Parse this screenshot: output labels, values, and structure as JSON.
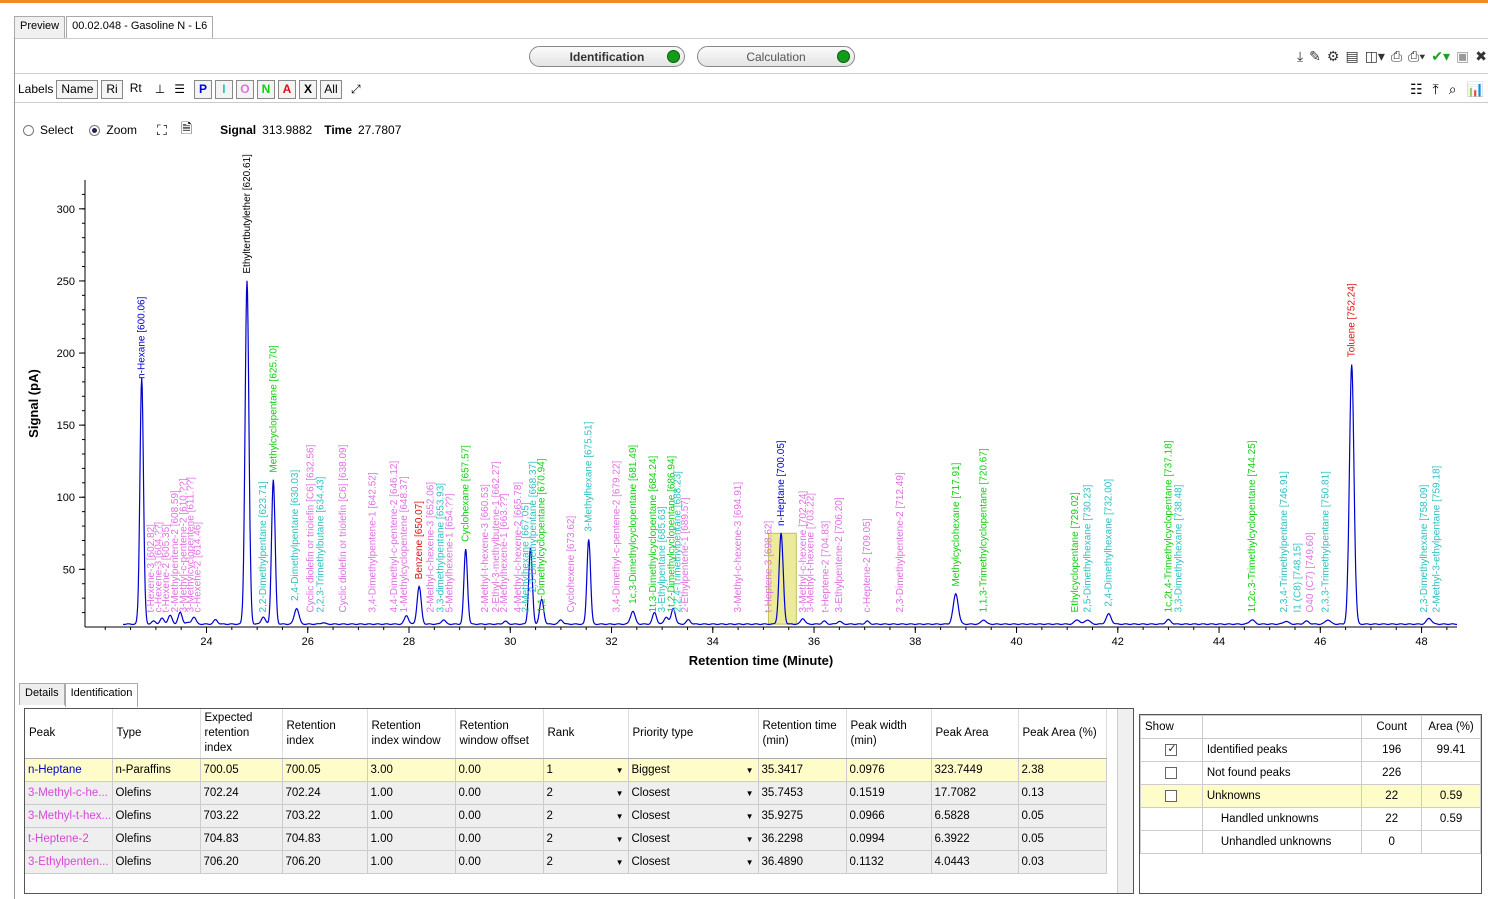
{
  "tabs": [
    {
      "label": "Preview"
    },
    {
      "label": "00.02.048 - Gasoline N - L6"
    }
  ],
  "toolbar": {
    "identification_label": "Identification",
    "calculation_label": "Calculation"
  },
  "label_bar": {
    "labels_label": "Labels",
    "name_btn": "Name",
    "ri_btn": "Ri",
    "rt_btn": "Rt",
    "class_buttons": [
      {
        "label": "P",
        "color": "#0000d0"
      },
      {
        "label": "I",
        "color": "#30c0c0"
      },
      {
        "label": "O",
        "color": "#e070e0"
      },
      {
        "label": "N",
        "color": "#10d010"
      },
      {
        "label": "A",
        "color": "#e01010"
      },
      {
        "label": "X",
        "color": "#000000"
      },
      {
        "label": "All",
        "color": "#000000"
      }
    ]
  },
  "select_bar": {
    "select_label": "Select",
    "zoom_label": "Zoom",
    "signal_label": "Signal",
    "signal_value": "313.9882",
    "time_label": "Time",
    "time_value": "27.7807"
  },
  "chart_data": {
    "type": "line",
    "xlabel": "Retention time (Minute)",
    "ylabel": "Signal (pA)",
    "xlim": [
      21.6,
      48.7
    ],
    "ylim": [
      10,
      320
    ],
    "xticks": [
      24,
      26,
      28,
      30,
      32,
      34,
      36,
      38,
      40,
      42,
      44,
      46,
      48
    ],
    "yticks": [
      50,
      100,
      150,
      200,
      250,
      300
    ],
    "baseline": 12,
    "highlight_range": [
      35.1,
      35.65
    ],
    "peaks": [
      {
        "t": 22.72,
        "h": 183,
        "w": 0.035
      },
      {
        "t": 22.95,
        "h": 14,
        "w": 0.04
      },
      {
        "t": 23.12,
        "h": 16,
        "w": 0.04
      },
      {
        "t": 23.28,
        "h": 18,
        "w": 0.04
      },
      {
        "t": 23.48,
        "h": 20,
        "w": 0.04
      },
      {
        "t": 23.62,
        "h": 13,
        "w": 0.04
      },
      {
        "t": 23.75,
        "h": 17,
        "w": 0.04
      },
      {
        "t": 24.18,
        "h": 15,
        "w": 0.04
      },
      {
        "t": 24.8,
        "h": 250,
        "w": 0.038
      },
      {
        "t": 25.12,
        "h": 17,
        "w": 0.04
      },
      {
        "t": 25.32,
        "h": 112,
        "w": 0.035
      },
      {
        "t": 25.78,
        "h": 23,
        "w": 0.045
      },
      {
        "t": 26.3,
        "h": 13,
        "w": 0.04
      },
      {
        "t": 27.95,
        "h": 18,
        "w": 0.04
      },
      {
        "t": 28.2,
        "h": 38,
        "w": 0.04
      },
      {
        "t": 28.68,
        "h": 15,
        "w": 0.04
      },
      {
        "t": 29.12,
        "h": 64,
        "w": 0.035
      },
      {
        "t": 29.9,
        "h": 14,
        "w": 0.04
      },
      {
        "t": 30.4,
        "h": 65,
        "w": 0.035
      },
      {
        "t": 30.62,
        "h": 29,
        "w": 0.04
      },
      {
        "t": 31.0,
        "h": 15,
        "w": 0.04
      },
      {
        "t": 31.55,
        "h": 71,
        "w": 0.035
      },
      {
        "t": 32.42,
        "h": 21,
        "w": 0.045
      },
      {
        "t": 32.85,
        "h": 20,
        "w": 0.04
      },
      {
        "t": 33.08,
        "h": 17,
        "w": 0.04
      },
      {
        "t": 33.22,
        "h": 23,
        "w": 0.04
      },
      {
        "t": 33.52,
        "h": 15,
        "w": 0.04
      },
      {
        "t": 35.35,
        "h": 75,
        "w": 0.04
      },
      {
        "t": 35.78,
        "h": 16,
        "w": 0.04
      },
      {
        "t": 36.2,
        "h": 14,
        "w": 0.04
      },
      {
        "t": 36.5,
        "h": 14,
        "w": 0.04
      },
      {
        "t": 37.05,
        "h": 14,
        "w": 0.04
      },
      {
        "t": 38.8,
        "h": 33,
        "w": 0.05
      },
      {
        "t": 39.35,
        "h": 15,
        "w": 0.045
      },
      {
        "t": 41.2,
        "h": 15,
        "w": 0.05
      },
      {
        "t": 41.4,
        "h": 15,
        "w": 0.05
      },
      {
        "t": 41.82,
        "h": 19,
        "w": 0.05
      },
      {
        "t": 43.0,
        "h": 15,
        "w": 0.05
      },
      {
        "t": 44.65,
        "h": 15,
        "w": 0.05
      },
      {
        "t": 45.32,
        "h": 14,
        "w": 0.05
      },
      {
        "t": 45.73,
        "h": 14,
        "w": 0.05
      },
      {
        "t": 46.15,
        "h": 15,
        "w": 0.05
      },
      {
        "t": 46.62,
        "h": 192,
        "w": 0.045
      },
      {
        "t": 48.15,
        "h": 16,
        "w": 0.05
      }
    ],
    "labels": [
      {
        "t": 22.72,
        "text": "n-Hexane [600.06]",
        "color": "#0000d0",
        "y": 180
      },
      {
        "t": 22.9,
        "text": "t-Hexene-3 [602.82]",
        "color": "#e070e0",
        "y": 18
      },
      {
        "t": 23.05,
        "text": "c-Hexene-3 [604.??]",
        "color": "#e070e0",
        "y": 18
      },
      {
        "t": 23.2,
        "text": "t-Hexene-2 [605.35]",
        "color": "#e070e0",
        "y": 18
      },
      {
        "t": 23.38,
        "text": "2-Methylpentene-2 [608.59]",
        "color": "#e070e0",
        "y": 18
      },
      {
        "t": 23.55,
        "text": "3-Methyl-c-pentene-2 [610.??]",
        "color": "#e070e0",
        "y": 18
      },
      {
        "t": 23.68,
        "text": "3-Methylcyclopentene [611.??]",
        "color": "#e070e0",
        "y": 18
      },
      {
        "t": 23.82,
        "text": "c-Hexene-2 [614.46]",
        "color": "#e070e0",
        "y": 18
      },
      {
        "t": 24.8,
        "text": "Ethyltertbutylether [620.61]",
        "color": "#000000",
        "y": 253
      },
      {
        "t": 25.12,
        "text": "2,2-Dimethylpentane [623.71]",
        "color": "#30c0c0",
        "y": 18
      },
      {
        "t": 25.32,
        "text": "Methylcyclopentane [625.70]",
        "color": "#10d010",
        "y": 115
      },
      {
        "t": 25.75,
        "text": "2,4-Dimethylpentane [630.03]",
        "color": "#30c0c0",
        "y": 26
      },
      {
        "t": 26.05,
        "text": "Cyclic diolefin or triolefin [C6] [632.56]",
        "color": "#e070e0",
        "y": 18
      },
      {
        "t": 26.25,
        "text": "2,2,3-Trimethylbutane [634.43]",
        "color": "#30c0c0",
        "y": 18
      },
      {
        "t": 26.7,
        "text": "Cyclic diolefin or triolefin [C6] [638.09]",
        "color": "#e070e0",
        "y": 18
      },
      {
        "t": 27.28,
        "text": "3,4-Dimethylpentene-1 [642.52]",
        "color": "#e070e0",
        "y": 18
      },
      {
        "t": 27.7,
        "text": "4,4-Dimethyl-c-pentene-2 [646.12]",
        "color": "#e070e0",
        "y": 18
      },
      {
        "t": 27.9,
        "text": "1-Methylcyclopentene [648.37]",
        "color": "#e070e0",
        "y": 18
      },
      {
        "t": 28.2,
        "text": "Benzene [650.07]",
        "color": "#e01010",
        "y": 41
      },
      {
        "t": 28.42,
        "text": "2-Methyl-c-hexene-3 [652.06]",
        "color": "#e070e0",
        "y": 18
      },
      {
        "t": 28.62,
        "text": "3,3-dimethylpentane [653.93]",
        "color": "#30c0c0",
        "y": 18
      },
      {
        "t": 28.8,
        "text": "5-Methylhexene-1 [654.??]",
        "color": "#e070e0",
        "y": 18
      },
      {
        "t": 29.12,
        "text": "Cyclohexane [657.57]",
        "color": "#10d010",
        "y": 67
      },
      {
        "t": 29.5,
        "text": "2-Methyl-t-hexene-3 [660.53]",
        "color": "#e070e0",
        "y": 18
      },
      {
        "t": 29.72,
        "text": "2-Ethyl-3-methylbutene-1 [662.27]",
        "color": "#e070e0",
        "y": 18
      },
      {
        "t": 29.88,
        "text": "2-Methylhexene-1 [663.??]",
        "color": "#e070e0",
        "y": 18
      },
      {
        "t": 30.15,
        "text": "4-Methyl-c-hexene-2 [665.78]",
        "color": "#e070e0",
        "y": 18
      },
      {
        "t": 30.3,
        "text": "2-Methylhexane [667.05]",
        "color": "#30c0c0",
        "y": 18
      },
      {
        "t": 30.45,
        "text": "2,3-Dimethylpentane [668.37]",
        "color": "#30c0c0",
        "y": 32
      },
      {
        "t": 30.62,
        "text": "1,1-Dimethylcyclopentane [670.94]",
        "color": "#10d010",
        "y": 18
      },
      {
        "t": 31.2,
        "text": "Cyclohexene [673.62]",
        "color": "#e070e0",
        "y": 18
      },
      {
        "t": 31.55,
        "text": "3-Methylhexane [675.51]",
        "color": "#30c0c0",
        "y": 74
      },
      {
        "t": 32.1,
        "text": "3,4-Dimethyl-c-pentene-2 [679.22]",
        "color": "#e070e0",
        "y": 18
      },
      {
        "t": 32.42,
        "text": "1c,3-Dimethylcyclopentane [681.49]",
        "color": "#10d010",
        "y": 24
      },
      {
        "t": 32.82,
        "text": "1t,3-Dimethylcyclopentane [684.24]",
        "color": "#10d010",
        "y": 18
      },
      {
        "t": 33.0,
        "text": "3-Ethylpentane [685.63]",
        "color": "#30c0c0",
        "y": 18
      },
      {
        "t": 33.18,
        "text": "1t,2-Dimethylcyclopentane [686.94]",
        "color": "#10d010",
        "y": 18
      },
      {
        "t": 33.3,
        "text": "2,2,4-Trimethylpentane [688.23]",
        "color": "#30c0c0",
        "y": 18
      },
      {
        "t": 33.45,
        "text": "2-Ethylpentene-1 [689.57]",
        "color": "#e070e0",
        "y": 18
      },
      {
        "t": 34.5,
        "text": "3-Methyl-c-hexene-3 [694.91]",
        "color": "#e070e0",
        "y": 18
      },
      {
        "t": 35.1,
        "text": "t-Heptene-3 [698.62]",
        "color": "#e070e0",
        "y": 18
      },
      {
        "t": 35.35,
        "text": "n-Heptane [700.05]",
        "color": "#0000d0",
        "y": 78
      },
      {
        "t": 35.78,
        "text": "3-Methyl-c-hexene [702.24]",
        "color": "#e070e0",
        "y": 18
      },
      {
        "t": 35.93,
        "text": "3-Methyl-t-hexene [703.22]",
        "color": "#e070e0",
        "y": 18
      },
      {
        "t": 36.23,
        "text": "t-Heptene-2 [704.83]",
        "color": "#e070e0",
        "y": 18
      },
      {
        "t": 36.49,
        "text": "3-Ethylpentene-2 [706.20]",
        "color": "#e070e0",
        "y": 18
      },
      {
        "t": 37.05,
        "text": "c-Heptene-2 [709.05]",
        "color": "#e070e0",
        "y": 18
      },
      {
        "t": 37.7,
        "text": "2,3-Dimethylpentene-2 [712.49]",
        "color": "#e070e0",
        "y": 18
      },
      {
        "t": 38.8,
        "text": "Methylcyclohexane [717.91]",
        "color": "#10d010",
        "y": 36
      },
      {
        "t": 39.35,
        "text": "1,1,3-Trimethylcyclopentane [720.67]",
        "color": "#10d010",
        "y": 18
      },
      {
        "t": 41.15,
        "text": "Ethylcyclopentane [729.02]",
        "color": "#10d010",
        "y": 18
      },
      {
        "t": 41.4,
        "text": "2,5-Dimethylhexane [730.23]",
        "color": "#30c0c0",
        "y": 18
      },
      {
        "t": 41.82,
        "text": "2,4-Dimethylhexane [732.00]",
        "color": "#30c0c0",
        "y": 22
      },
      {
        "t": 43.0,
        "text": "1c,2t,4-Trimethylcyclopentane [737.18]",
        "color": "#10d010",
        "y": 18
      },
      {
        "t": 43.2,
        "text": "3,3-Dimethylhexane [738.48]",
        "color": "#30c0c0",
        "y": 18
      },
      {
        "t": 44.65,
        "text": "1t,2c,3-Trimethylcyclopentane [744.25]",
        "color": "#10d010",
        "y": 18
      },
      {
        "t": 45.28,
        "text": "2,3,4-Trimethylpentane [746.91]",
        "color": "#30c0c0",
        "y": 18
      },
      {
        "t": 45.55,
        "text": "I1 (C8) [748.15]",
        "color": "#30c0c0",
        "y": 18
      },
      {
        "t": 45.8,
        "text": "O40 (C7) [749.60]",
        "color": "#e070e0",
        "y": 18
      },
      {
        "t": 46.1,
        "text": "2,3,3-Trimethylpentane [750.81]",
        "color": "#30c0c0",
        "y": 18
      },
      {
        "t": 46.62,
        "text": "Toluene [752.24]",
        "color": "#e01010",
        "y": 195
      },
      {
        "t": 48.05,
        "text": "2,3-Dimethylhexane [758.09]",
        "color": "#30c0c0",
        "y": 18
      },
      {
        "t": 48.3,
        "text": "2-Methyl-3-ethylpentane [759.18]",
        "color": "#30c0c0",
        "y": 18
      }
    ]
  },
  "bottom_tabs": [
    {
      "label": "Details"
    },
    {
      "label": "Identification"
    }
  ],
  "peak_table": {
    "headers": [
      "Peak",
      "Type",
      "Expected retention index",
      "Retention index",
      "Retention index window",
      "Retention window offset",
      "Rank",
      "Priority type",
      "Retention time (min)",
      "Peak width (min)",
      "Peak Area",
      "Peak Area (%)"
    ],
    "rows": [
      [
        "n-Heptane",
        "n-Paraffins",
        "700.05",
        "700.05",
        "3.00",
        "0.00",
        "1",
        "Biggest",
        "35.3417",
        "0.0976",
        "323.7449",
        "2.38"
      ],
      [
        "3-Methyl-c-he...",
        "Olefins",
        "702.24",
        "702.24",
        "1.00",
        "0.00",
        "2",
        "Closest",
        "35.7453",
        "0.1519",
        "17.7082",
        "0.13"
      ],
      [
        "3-Methyl-t-hex...",
        "Olefins",
        "703.22",
        "703.22",
        "1.00",
        "0.00",
        "2",
        "Closest",
        "35.9275",
        "0.0966",
        "6.5828",
        "0.05"
      ],
      [
        "t-Heptene-2",
        "Olefins",
        "704.83",
        "704.83",
        "1.00",
        "0.00",
        "2",
        "Closest",
        "36.2298",
        "0.0994",
        "6.3922",
        "0.05"
      ],
      [
        "3-Ethylpenten...",
        "Olefins",
        "706.20",
        "706.20",
        "1.00",
        "0.00",
        "2",
        "Closest",
        "36.4890",
        "0.1132",
        "4.0443",
        "0.03"
      ]
    ]
  },
  "summary": {
    "headers": [
      "Show",
      "",
      "Count",
      "Area (%)"
    ],
    "rows": [
      {
        "checked": true,
        "label": "Identified peaks",
        "count": "196",
        "area": "99.41"
      },
      {
        "checked": false,
        "label": "Not found peaks",
        "count": "226",
        "area": ""
      },
      {
        "checked": false,
        "label": "Unknowns",
        "count": "22",
        "area": "0.59"
      },
      {
        "checked": null,
        "label": "Handled unknowns",
        "count": "22",
        "area": "0.59"
      },
      {
        "checked": null,
        "label": "Unhandled unknowns",
        "count": "0",
        "area": ""
      }
    ]
  }
}
